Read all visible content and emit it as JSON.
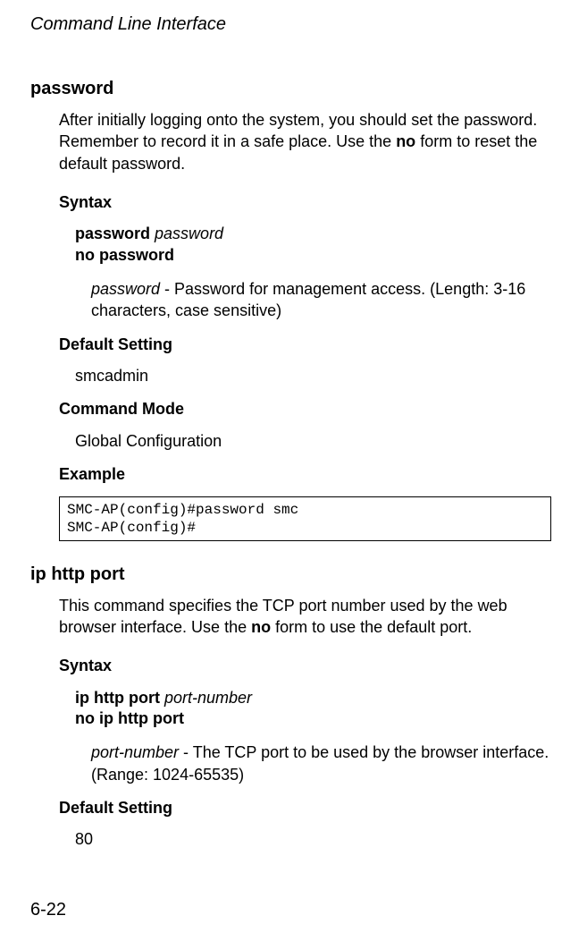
{
  "header": "Command Line Interface",
  "pageNumber": "6-22",
  "section1": {
    "title": "password",
    "intro": {
      "part1": "After initially logging onto the system, you should set the password. Remember to record it in a safe place. Use the ",
      "bold": "no",
      "part2": " form to reset the default password."
    },
    "syntax": {
      "label": "Syntax",
      "line1_bold": "password ",
      "line1_italic": "password",
      "line2_bold": "no password",
      "param_italic": "password",
      "param_rest": " - Password for management access. (Length: 3-16 characters, case sensitive)"
    },
    "defaultSetting": {
      "label": "Default Setting",
      "value": "smcadmin"
    },
    "commandMode": {
      "label": "Command Mode",
      "value": "Global Configuration"
    },
    "example": {
      "label": "Example",
      "code": "SMC-AP(config)#password smc\nSMC-AP(config)#"
    }
  },
  "section2": {
    "title": "ip http port",
    "intro": {
      "part1": "This command specifies the TCP port number used by the web browser interface. Use the ",
      "bold": "no",
      "part2": " form to use the default port."
    },
    "syntax": {
      "label": "Syntax",
      "line1_bold": "ip http port ",
      "line1_italic": "port-number",
      "line2_bold": "no ip http port",
      "param_italic": "port-number",
      "param_rest": " - The TCP port to be used by the browser interface. (Range: 1024-65535)"
    },
    "defaultSetting": {
      "label": "Default Setting",
      "value": "80"
    }
  }
}
